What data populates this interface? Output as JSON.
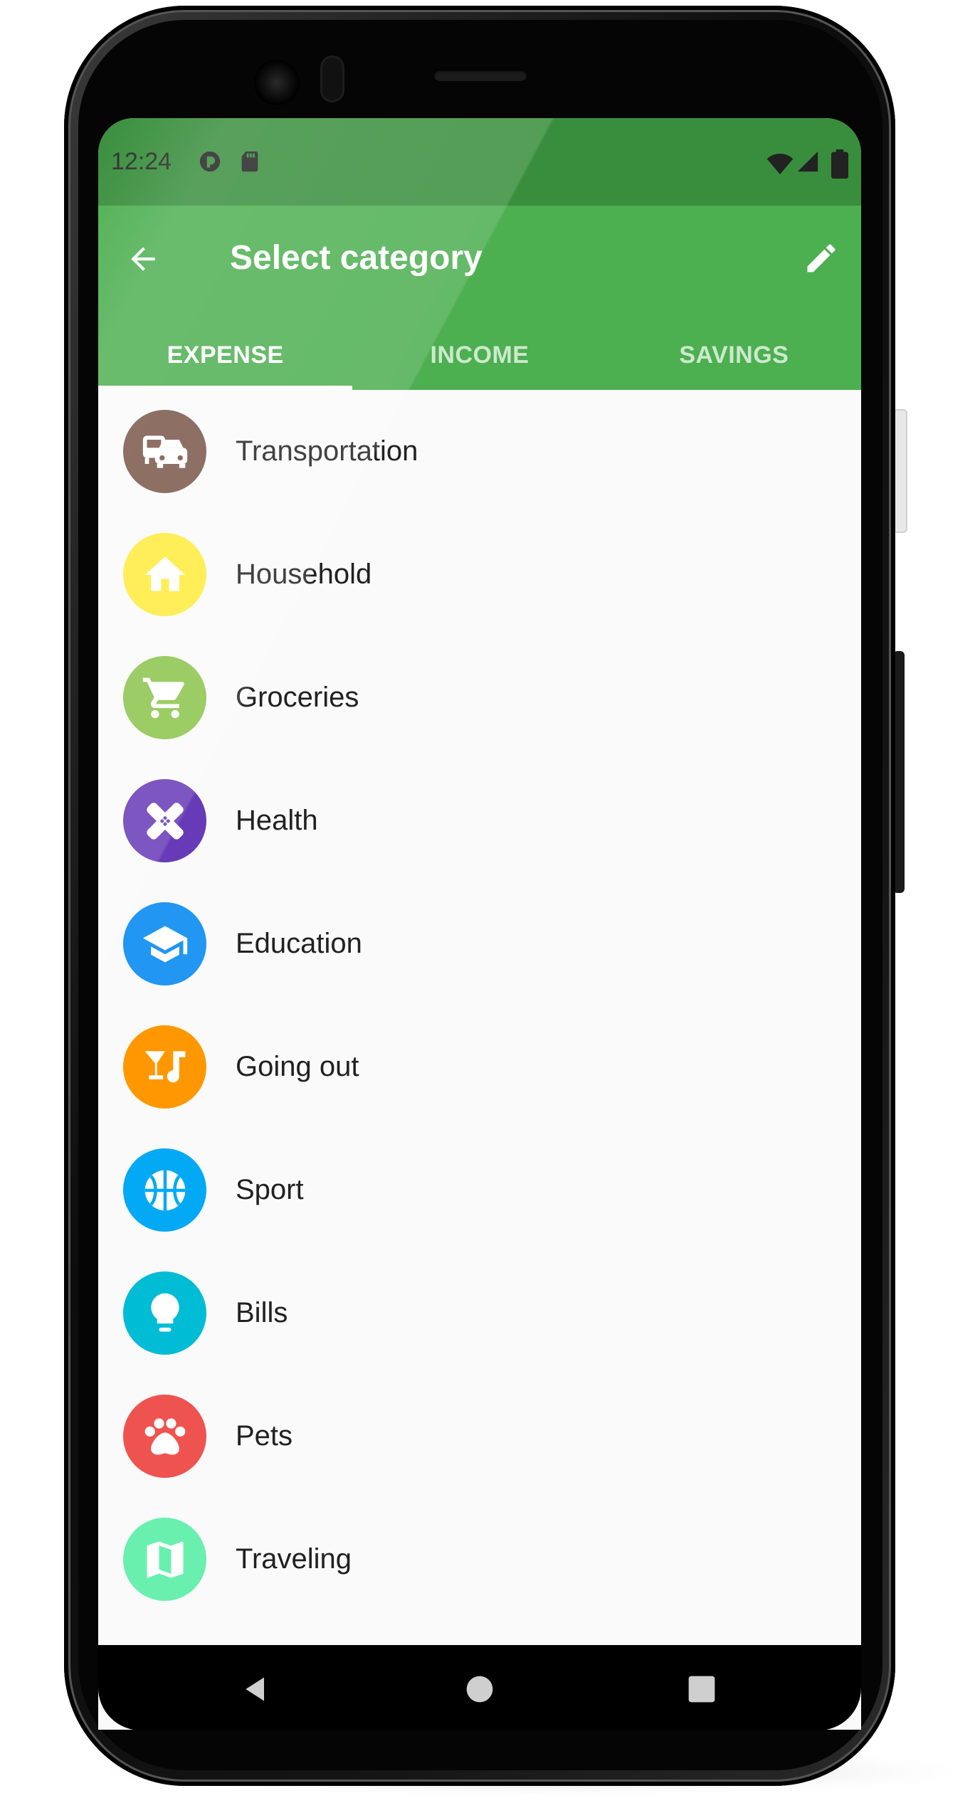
{
  "status_bar": {
    "time": "12:24"
  },
  "app_bar": {
    "title": "Select category"
  },
  "tabs": [
    {
      "label": "EXPENSE",
      "active": true
    },
    {
      "label": "INCOME",
      "active": false
    },
    {
      "label": "SAVINGS",
      "active": false
    }
  ],
  "categories": [
    {
      "label": "Transportation",
      "icon": "transportation-icon",
      "color": "#795548"
    },
    {
      "label": "Household",
      "icon": "home-icon",
      "color": "#ffeb3b"
    },
    {
      "label": "Groceries",
      "icon": "cart-icon",
      "color": "#8bc34a"
    },
    {
      "label": "Health",
      "icon": "bandage-icon",
      "color": "#673ab7"
    },
    {
      "label": "Education",
      "icon": "graduation-cap-icon",
      "color": "#2196f3"
    },
    {
      "label": "Going out",
      "icon": "cocktail-music-icon",
      "color": "#ff9800"
    },
    {
      "label": "Sport",
      "icon": "basketball-icon",
      "color": "#03a9f4"
    },
    {
      "label": "Bills",
      "icon": "lightbulb-icon",
      "color": "#00bcd4"
    },
    {
      "label": "Pets",
      "icon": "paw-icon",
      "color": "#ef5350"
    },
    {
      "label": "Traveling",
      "icon": "map-icon",
      "color": "#69f0ae"
    }
  ],
  "colors": {
    "primary": "#4caf50",
    "status_bar": "#388e3c"
  }
}
